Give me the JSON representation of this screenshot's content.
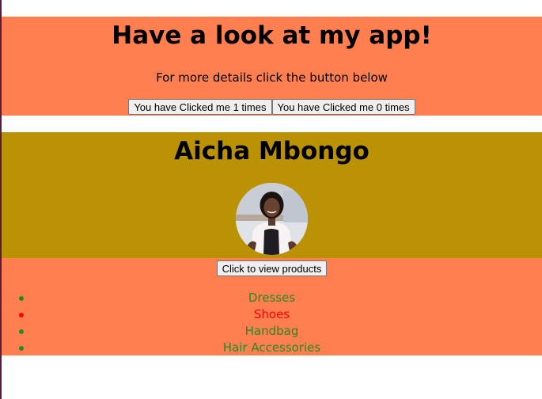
{
  "app_section": {
    "title": "Have a look at my app!",
    "subtitle": "For more details click the button below",
    "buttons": [
      {
        "label": "You have Clicked me 1 times"
      },
      {
        "label": "You have Clicked me 0 times"
      }
    ],
    "background": "#ff7f50"
  },
  "profile_section": {
    "name": "Aicha Mbongo",
    "background": "#bb9204"
  },
  "products_section": {
    "button_label": "Click to view products",
    "background": "#ff7f50",
    "items": [
      {
        "label": "Dresses",
        "color": "#228b22"
      },
      {
        "label": "Shoes",
        "color": "#ff0000"
      },
      {
        "label": "Handbag",
        "color": "#228b22"
      },
      {
        "label": "Hair Accessories",
        "color": "#228b22"
      }
    ]
  }
}
